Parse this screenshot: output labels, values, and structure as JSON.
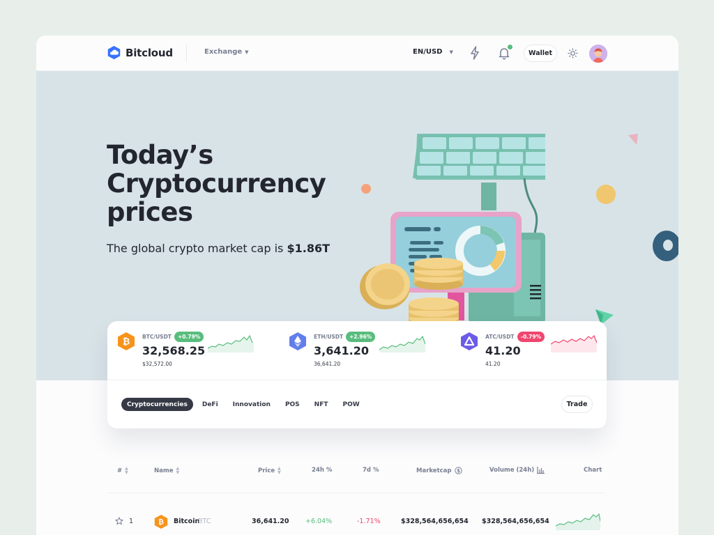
{
  "brand": {
    "name": "Bitcloud"
  },
  "header": {
    "nav_exchange": "Exchange",
    "language": "EN/USD",
    "wallet_label": "Wallet"
  },
  "hero": {
    "title_lines": [
      "Today’s",
      "Cryptocurrency",
      "prices"
    ],
    "subtitle_prefix": "The global crypto market cap is",
    "subtitle_value": "$1.86T"
  },
  "tickers": [
    {
      "pair": "BTC/USDT",
      "change": "+0.79%",
      "price": "32,568.25",
      "sub_price": "$32,572.00",
      "trend": "up",
      "color": "#f7931a"
    },
    {
      "pair": "ETH/USDT",
      "change": "+2.96%",
      "price": "3,641.20",
      "sub_price": "36,641.20",
      "trend": "up",
      "color": "#627eea"
    },
    {
      "pair": "ATC/USDT",
      "change": "-0.79%",
      "price": "41.20",
      "sub_price": "41.20",
      "trend": "down",
      "color": "#6b5ce7"
    }
  ],
  "tabs": [
    {
      "label": "Cryptocurrencies",
      "active": true
    },
    {
      "label": "DeFi",
      "active": false
    },
    {
      "label": "Innovation",
      "active": false
    },
    {
      "label": "POS",
      "active": false
    },
    {
      "label": "NFT",
      "active": false
    },
    {
      "label": "POW",
      "active": false
    }
  ],
  "trade_label": "Trade",
  "table": {
    "headers": [
      "#",
      "Name",
      "Price",
      "24h %",
      "7d %",
      "Marketcap",
      "Volume (24h)",
      "Chart"
    ],
    "rows": [
      {
        "rank": "1",
        "name": "Bitcoin",
        "symbol": "BTC",
        "price": "36,641.20",
        "change_24h": "+6.04%",
        "change_7d": "-1.71%",
        "marketcap": "$328,564,656,654",
        "volume": "$328,564,656,654"
      }
    ]
  },
  "colors": {
    "up": "#58bd7d",
    "down": "#ef466f",
    "brand": "#3772ff",
    "hero_bg": "#d8e3e8"
  }
}
